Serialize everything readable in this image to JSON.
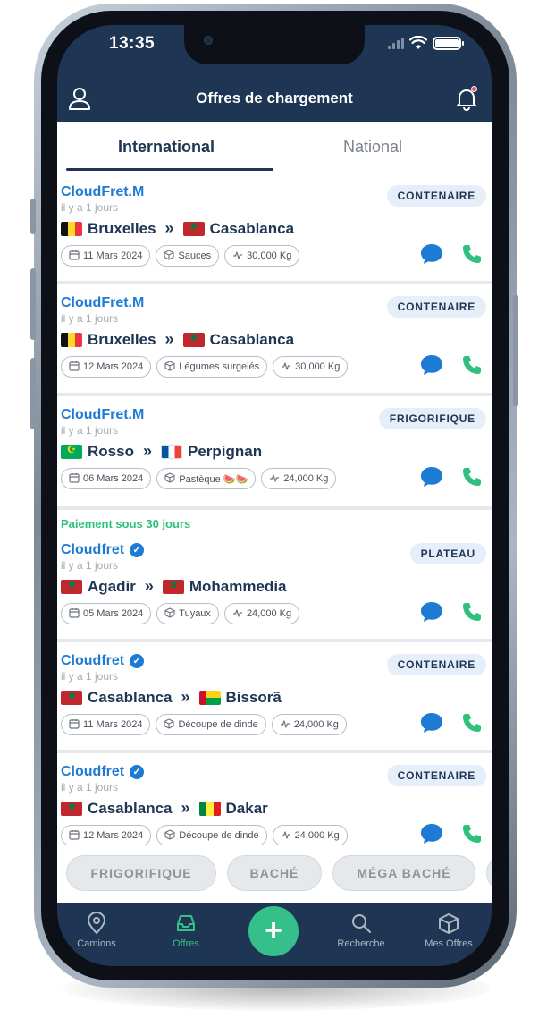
{
  "status_bar": {
    "time": "13:35"
  },
  "header": {
    "title": "Offres de chargement"
  },
  "tabs": [
    {
      "label": "International",
      "active": true
    },
    {
      "label": "National",
      "active": false
    }
  ],
  "cards": [
    {
      "note": "",
      "company": "CloudFret.M",
      "verified": false,
      "ago": "il y a 1 jours",
      "badge": "CONTENAIRE",
      "from": "Bruxelles",
      "from_flag": "be",
      "to": "Casablanca",
      "to_flag": "ma",
      "date": "11 Mars 2024",
      "goods": "Sauces",
      "weight": "30,000 Kg"
    },
    {
      "note": "",
      "company": "CloudFret.M",
      "verified": false,
      "ago": "il y a 1 jours",
      "badge": "CONTENAIRE",
      "from": "Bruxelles",
      "from_flag": "be",
      "to": "Casablanca",
      "to_flag": "ma",
      "date": "12 Mars 2024",
      "goods": "Légumes surgelés",
      "weight": "30,000 Kg"
    },
    {
      "note": "",
      "company": "CloudFret.M",
      "verified": false,
      "ago": "il y a 1 jours",
      "badge": "FRIGORIFIQUE",
      "from": "Rosso",
      "from_flag": "mr",
      "to": "Perpignan",
      "to_flag": "fr",
      "date": "06 Mars 2024",
      "goods": "Pastèque 🍉🍉",
      "weight": "24,000 Kg"
    },
    {
      "note": "Paiement sous 30 jours",
      "company": "Cloudfret",
      "verified": true,
      "ago": "il y a 1 jours",
      "badge": "PLATEAU",
      "from": "Agadir",
      "from_flag": "ma",
      "to": "Mohammedia",
      "to_flag": "ma",
      "date": "05 Mars 2024",
      "goods": "Tuyaux",
      "weight": "24,000 Kg"
    },
    {
      "note": "",
      "company": "Cloudfret",
      "verified": true,
      "ago": "il y a 1 jours",
      "badge": "CONTENAIRE",
      "from": "Casablanca",
      "from_flag": "ma",
      "to": "Bissorã",
      "to_flag": "gw",
      "date": "11 Mars 2024",
      "goods": "Découpe de dinde",
      "weight": "24,000 Kg"
    },
    {
      "note": "",
      "company": "Cloudfret",
      "verified": true,
      "ago": "il y a 1 jours",
      "badge": "CONTENAIRE",
      "from": "Casablanca",
      "from_flag": "ma",
      "to": "Dakar",
      "to_flag": "sn",
      "date": "12 Mars 2024",
      "goods": "Découpe de dinde",
      "weight": "24,000 Kg"
    }
  ],
  "filters": [
    "FRIGORIFIQUE",
    "BACHÉ",
    "MÉGA BACHÉ"
  ],
  "bottom_nav": [
    {
      "label": "Camions",
      "icon": "location-pin-icon",
      "active": false
    },
    {
      "label": "Offres",
      "icon": "inbox-icon",
      "active": true
    },
    {
      "label": "Recherche",
      "icon": "search-icon",
      "active": false
    },
    {
      "label": "Mes Offres",
      "icon": "box-icon",
      "active": false
    }
  ],
  "colors": {
    "primary": "#1e3553",
    "accent": "#35c08b",
    "link": "#1d7bd4",
    "chat": "#1d7bd4",
    "call": "#2fbf7f"
  }
}
